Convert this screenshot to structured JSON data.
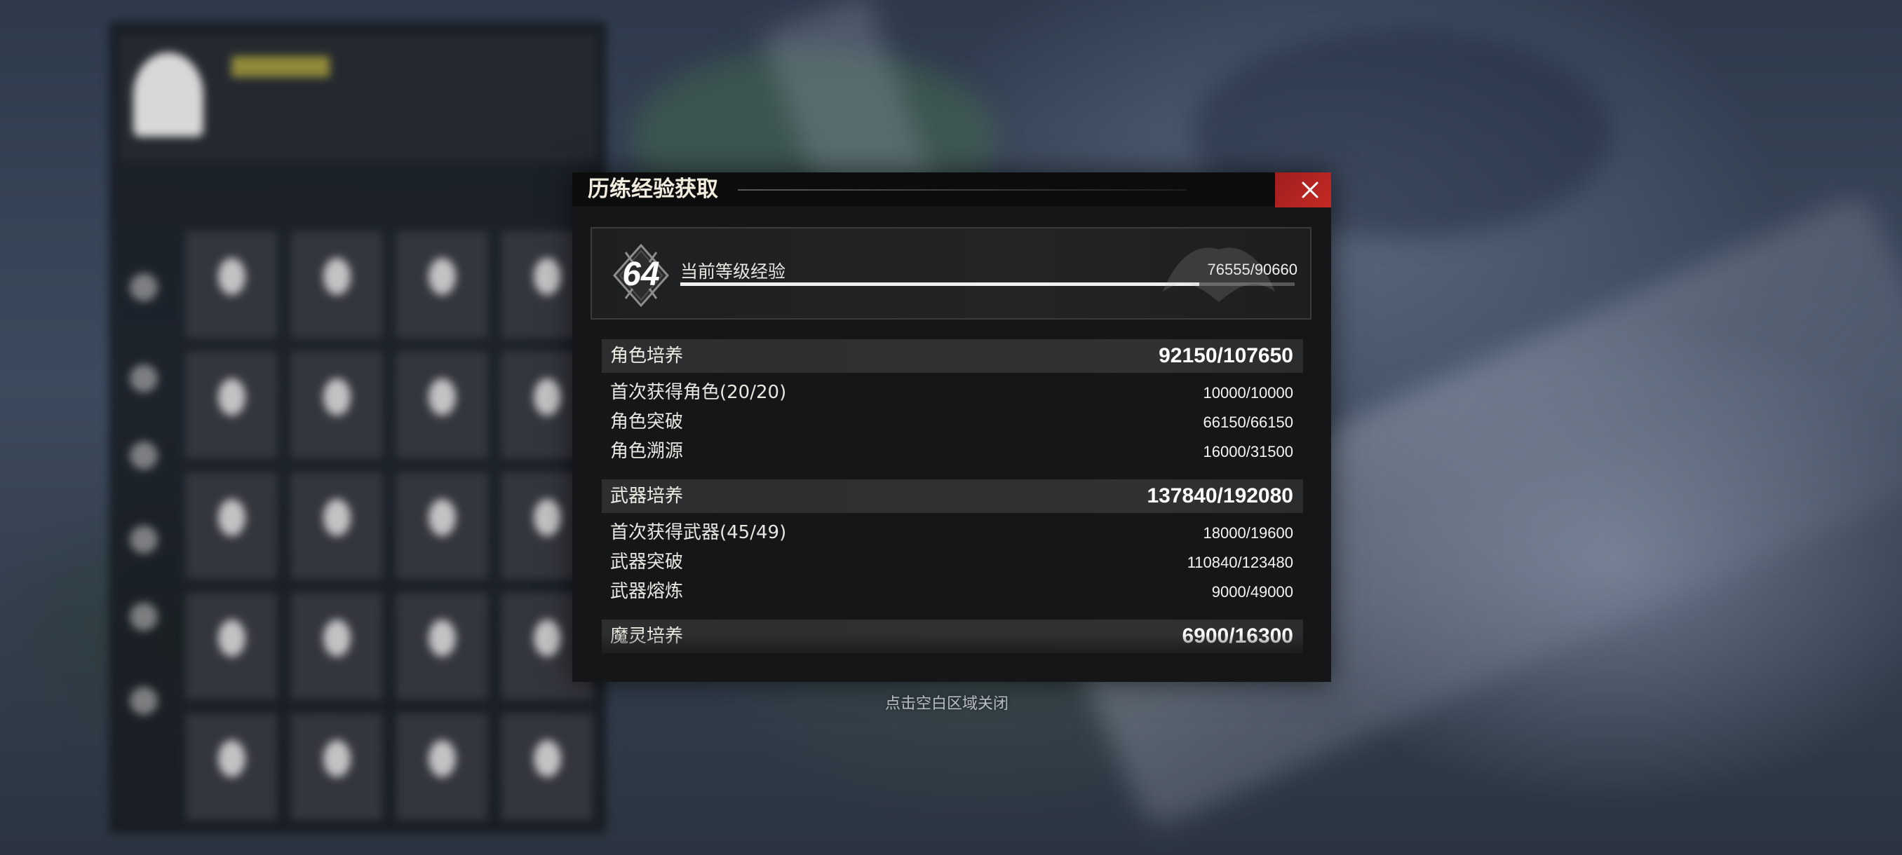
{
  "dialog": {
    "title": "历练经验获取",
    "close_icon": "close-icon",
    "accent_color": "#c52a24"
  },
  "level": {
    "number": "64",
    "label": "当前等级经验",
    "value_text": "76555/90660",
    "current": 76555,
    "max": 90660
  },
  "sections": [
    {
      "name": "角色培养",
      "value": "92150/107650",
      "rows": [
        {
          "name": "首次获得角色(20/20)",
          "value": "10000/10000"
        },
        {
          "name": "角色突破",
          "value": "66150/66150"
        },
        {
          "name": "角色溯源",
          "value": "16000/31500"
        }
      ]
    },
    {
      "name": "武器培养",
      "value": "137840/192080",
      "rows": [
        {
          "name": "首次获得武器(45/49)",
          "value": "18000/19600"
        },
        {
          "name": "武器突破",
          "value": "110840/123480"
        },
        {
          "name": "武器熔炼",
          "value": "9000/49000"
        }
      ]
    },
    {
      "name": "魔灵培养",
      "value": "6900/16300",
      "rows": []
    }
  ],
  "hint": "点击空白区域关闭"
}
